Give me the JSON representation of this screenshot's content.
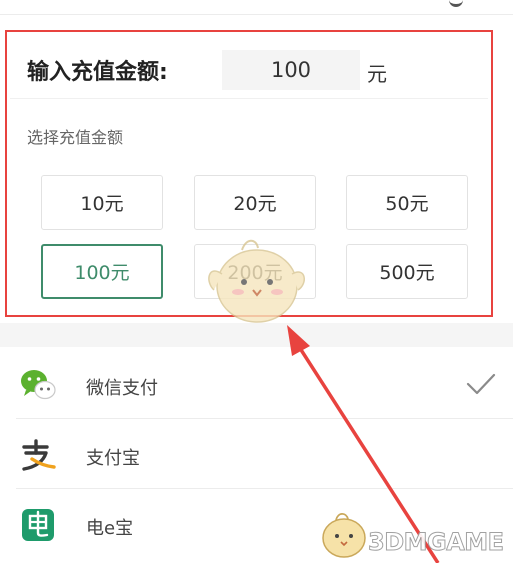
{
  "recharge": {
    "input_label": "输入充值金额:",
    "input_value": "100",
    "unit": "元",
    "select_label": "选择充值金额",
    "options": [
      {
        "label": "10元",
        "selected": false
      },
      {
        "label": "20元",
        "selected": false
      },
      {
        "label": "50元",
        "selected": false
      },
      {
        "label": "100元",
        "selected": true
      },
      {
        "label": "200元",
        "selected": false
      },
      {
        "label": "500元",
        "selected": false
      }
    ]
  },
  "payment": {
    "methods": [
      {
        "label": "微信支付",
        "icon": "wechat-pay-icon",
        "checked": true
      },
      {
        "label": "支付宝",
        "icon": "alipay-icon",
        "checked": false
      },
      {
        "label": "电e宝",
        "icon": "dianebao-icon",
        "checked": false
      }
    ]
  },
  "watermark": {
    "text": "3DMGAME"
  },
  "colors": {
    "highlight_box": "#e8433f",
    "selected_accent": "#3f8c6b",
    "annotation_arrow": "#e8433f",
    "wechat_green": "#5bb12f",
    "alipay_orange": "#f0a21e",
    "dianebao_green": "#1e9b6b"
  }
}
